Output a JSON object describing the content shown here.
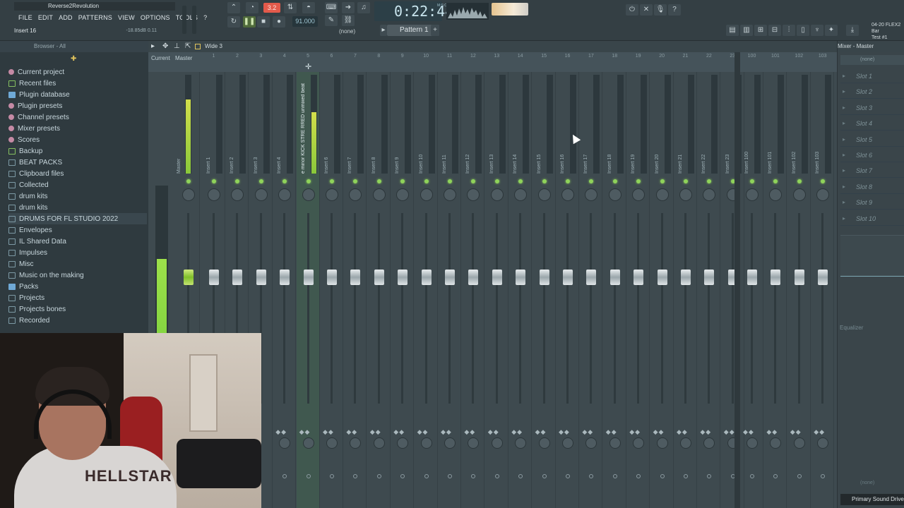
{
  "window": {
    "title": "Reverse2Revolution"
  },
  "menu": [
    "FILE",
    "EDIT",
    "ADD",
    "PATTERNS",
    "VIEW",
    "OPTIONS",
    "TOOLS",
    "?"
  ],
  "hint": {
    "text": "Insert 16",
    "value": "-18.85dB  0.11"
  },
  "transport": {
    "tempo_mode": "3.2",
    "bpm": "91.000",
    "time": "0:22:44",
    "time_unit": "M:S:CS",
    "pattern": "Pattern 1",
    "none_select": "(none)"
  },
  "project_badge": {
    "line1": "04-20",
    "line2": "FLEX2 Bar",
    "line3": "Test #1"
  },
  "browser": {
    "header": "Browser - All",
    "items": [
      {
        "label": "Current project",
        "icon": "current-project-icon",
        "color": "pink"
      },
      {
        "label": "Recent files",
        "icon": "recent-files-icon",
        "color": "green"
      },
      {
        "label": "Plugin database",
        "icon": "plugin-database-icon",
        "color": "blue"
      },
      {
        "label": "Plugin presets",
        "icon": "plugin-presets-icon",
        "color": "pink"
      },
      {
        "label": "Channel presets",
        "icon": "channel-presets-icon",
        "color": "pink"
      },
      {
        "label": "Mixer presets",
        "icon": "mixer-presets-icon",
        "color": "pink"
      },
      {
        "label": "Scores",
        "icon": "scores-icon",
        "color": "pink"
      },
      {
        "label": "Backup",
        "icon": "backup-icon",
        "color": "green"
      },
      {
        "label": "BEAT PACKS",
        "icon": "folder-icon",
        "color": ""
      },
      {
        "label": "Clipboard files",
        "icon": "folder-icon",
        "color": ""
      },
      {
        "label": "Collected",
        "icon": "folder-icon",
        "color": ""
      },
      {
        "label": "drum kits",
        "icon": "folder-icon",
        "color": ""
      },
      {
        "label": "drum kits",
        "icon": "folder-icon",
        "color": ""
      },
      {
        "label": "DRUMS FOR FL STUDIO 2022",
        "icon": "folder-icon",
        "color": ""
      },
      {
        "label": "Envelopes",
        "icon": "folder-icon",
        "color": ""
      },
      {
        "label": "IL Shared Data",
        "icon": "folder-icon",
        "color": ""
      },
      {
        "label": "Impulses",
        "icon": "folder-icon",
        "color": ""
      },
      {
        "label": "Misc",
        "icon": "folder-icon",
        "color": ""
      },
      {
        "label": "Music on the making",
        "icon": "folder-icon",
        "color": ""
      },
      {
        "label": "Packs",
        "icon": "folder-icon",
        "color": "blue"
      },
      {
        "label": "Projects",
        "icon": "folder-icon",
        "color": ""
      },
      {
        "label": "Projects bones",
        "icon": "folder-icon",
        "color": ""
      },
      {
        "label": "Recorded",
        "icon": "folder-icon",
        "color": ""
      }
    ]
  },
  "mixer": {
    "preset": "Wide 3",
    "header_current": "Current",
    "header_master": "Master",
    "strips": [
      {
        "name": "Master",
        "num": ""
      },
      {
        "name": "Insert 1",
        "num": "1"
      },
      {
        "name": "Insert 2",
        "num": "2"
      },
      {
        "name": "Insert 3",
        "num": "3"
      },
      {
        "name": "Insert 4",
        "num": "4"
      },
      {
        "name": "e minor KICK STRE RRED unmixed beat",
        "num": "5"
      },
      {
        "name": "Insert 6",
        "num": "6"
      },
      {
        "name": "Insert 7",
        "num": "7"
      },
      {
        "name": "Insert 8",
        "num": "8"
      },
      {
        "name": "Insert 9",
        "num": "9"
      },
      {
        "name": "Insert 10",
        "num": "10"
      },
      {
        "name": "Insert 11",
        "num": "11"
      },
      {
        "name": "Insert 12",
        "num": "12"
      },
      {
        "name": "Insert 13",
        "num": "13"
      },
      {
        "name": "Insert 14",
        "num": "14"
      },
      {
        "name": "Insert 15",
        "num": "15"
      },
      {
        "name": "Insert 16",
        "num": "16"
      },
      {
        "name": "Insert 17",
        "num": "17"
      },
      {
        "name": "Insert 18",
        "num": "18"
      },
      {
        "name": "Insert 19",
        "num": "19"
      },
      {
        "name": "Insert 20",
        "num": "20"
      },
      {
        "name": "Insert 21",
        "num": "21"
      },
      {
        "name": "Insert 22",
        "num": "22"
      },
      {
        "name": "Insert 23",
        "num": "23"
      },
      {
        "name": "Insert 100",
        "num": "100"
      },
      {
        "name": "Insert 101",
        "num": "101"
      },
      {
        "name": "Insert 102",
        "num": "102"
      },
      {
        "name": "Insert 103",
        "num": "103"
      }
    ],
    "selected_strip_number": "5",
    "master_level": 0.75,
    "strip5_level": 0.62
  },
  "fx_panel": {
    "title": "Mixer - Master",
    "input": "(none)",
    "slots": [
      "Slot 1",
      "Slot 2",
      "Slot 3",
      "Slot 4",
      "Slot 5",
      "Slot 6",
      "Slot 7",
      "Slot 8",
      "Slot 9",
      "Slot 10"
    ],
    "eq_label": "Equalizer",
    "output": "(none)",
    "driver": "Primary Sound Driver"
  },
  "webcam": {
    "shirt_text": "HELLSTAR"
  },
  "colors": {
    "accent_green": "#8fd35a",
    "tempo_red": "#e35a4b",
    "selected_strip": "#40584f"
  }
}
